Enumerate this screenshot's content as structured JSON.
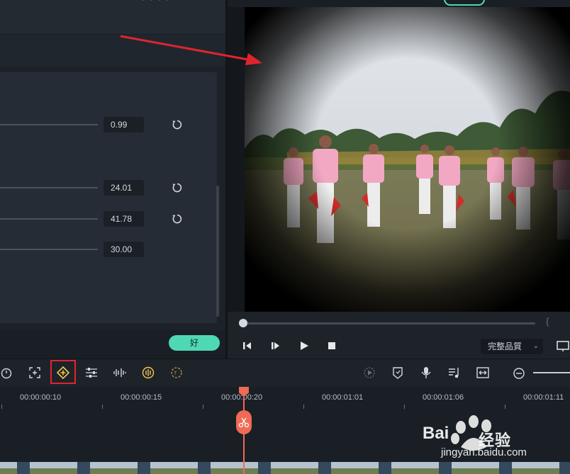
{
  "window": {
    "title_fragment": "· · · ·",
    "export_label": ""
  },
  "properties": {
    "rows": [
      {
        "value": "0.99",
        "has_reset": true
      },
      {
        "value": "24.01",
        "has_reset": true
      },
      {
        "value": "41.78",
        "has_reset": true
      },
      {
        "value": "30.00",
        "has_reset": false
      }
    ],
    "ok_label": "好"
  },
  "preview": {
    "scene": "vignette-effect-preview",
    "brace": "{"
  },
  "playback": {
    "quality_label": "完整品質",
    "quality_caret": "⌄"
  },
  "toolbar": {
    "left_icons": [
      "timer-icon",
      "crop-icon",
      "keyframe-icon",
      "adjust-icon",
      "audio-split-icon",
      "color-match-icon",
      "speed-icon"
    ],
    "right_icons": [
      "render-icon",
      "marker-icon",
      "mic-icon",
      "music-icon",
      "fit-icon",
      "zoom-out-icon"
    ],
    "highlight_color": "#e0242d"
  },
  "timeline": {
    "times": [
      "00:00:00:10",
      "00:00:00:15",
      "00:00:00:20",
      "00:00:01:01",
      "00:00:01:06",
      "00:00:01:11"
    ],
    "playhead_color": "#f06a55"
  },
  "watermark": {
    "brand": "经验",
    "url": "jingyan.baidu.com"
  },
  "colors": {
    "accent": "#4fd8b4",
    "annotation_arrow": "#e0242d"
  }
}
